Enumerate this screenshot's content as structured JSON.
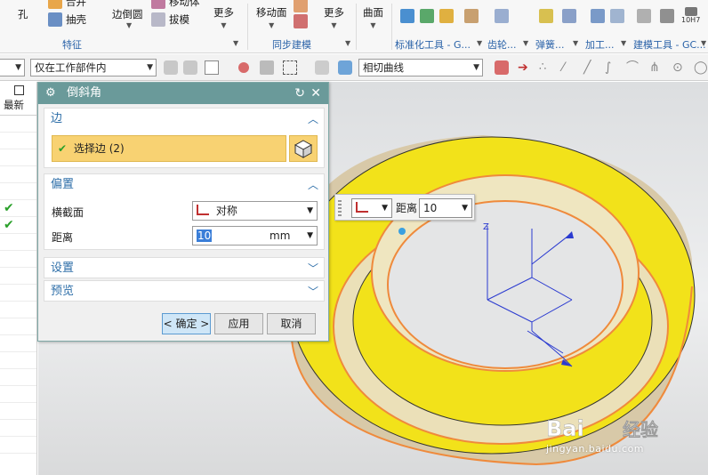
{
  "ribbon": {
    "items": {
      "hole": "孔",
      "combine": "合并",
      "shell": "抽壳",
      "edge_blend": "边倒圆",
      "move_body": "移动体",
      "draft": "拔模",
      "more1": "更多",
      "move_face": "移动面",
      "more2": "更多",
      "surface": "曲面"
    },
    "groups": {
      "feature": "特征",
      "sync_modeling": "同步建模",
      "standard_tools": "标准化工具 - G...",
      "gear": "齿轮...",
      "spring": "弹簧...",
      "machining": "加工...",
      "modeling_tools": "建模工具 - GC..."
    },
    "small_icon_label": "10H7"
  },
  "selection_bar": {
    "type_filter": "",
    "scope": "仅在工作部件内",
    "curve_rule": "相切曲线"
  },
  "navigator": {
    "column_header": "最新",
    "checked_rows": [
      6,
      7
    ]
  },
  "dialog": {
    "title": "倒斜角",
    "edge_section": {
      "header": "边",
      "select_label": "选择边 (2)"
    },
    "offset_section": {
      "header": "偏置",
      "cross_section_label": "横截面",
      "cross_section_value": "对称",
      "distance_label": "距离",
      "distance_value": "10",
      "distance_unit": "mm"
    },
    "settings_header": "设置",
    "preview_header": "预览",
    "buttons": {
      "ok": "< 确定 >",
      "apply": "应用",
      "cancel": "取消"
    }
  },
  "floating_input": {
    "distance_label": "距离",
    "distance_value": "10"
  },
  "watermark": {
    "text": "jingyan.baidu.com",
    "logo": "Baidu 经验"
  },
  "colors": {
    "dialog_title_bg": "#6a9a9a",
    "selected_row": "#f8d272",
    "section_header": "#2d6ea8",
    "face_yellow": "#f2e21a",
    "edge_orange": "#ef8a3c",
    "chamfer_face": "#ebe0b8",
    "check_green": "#2aa02a"
  },
  "icons": [
    "gear-icon",
    "reset-icon",
    "close-icon",
    "check-icon",
    "cube-select-icon",
    "chevron-up-icon",
    "chevron-down-icon",
    "cross-section-icon"
  ]
}
